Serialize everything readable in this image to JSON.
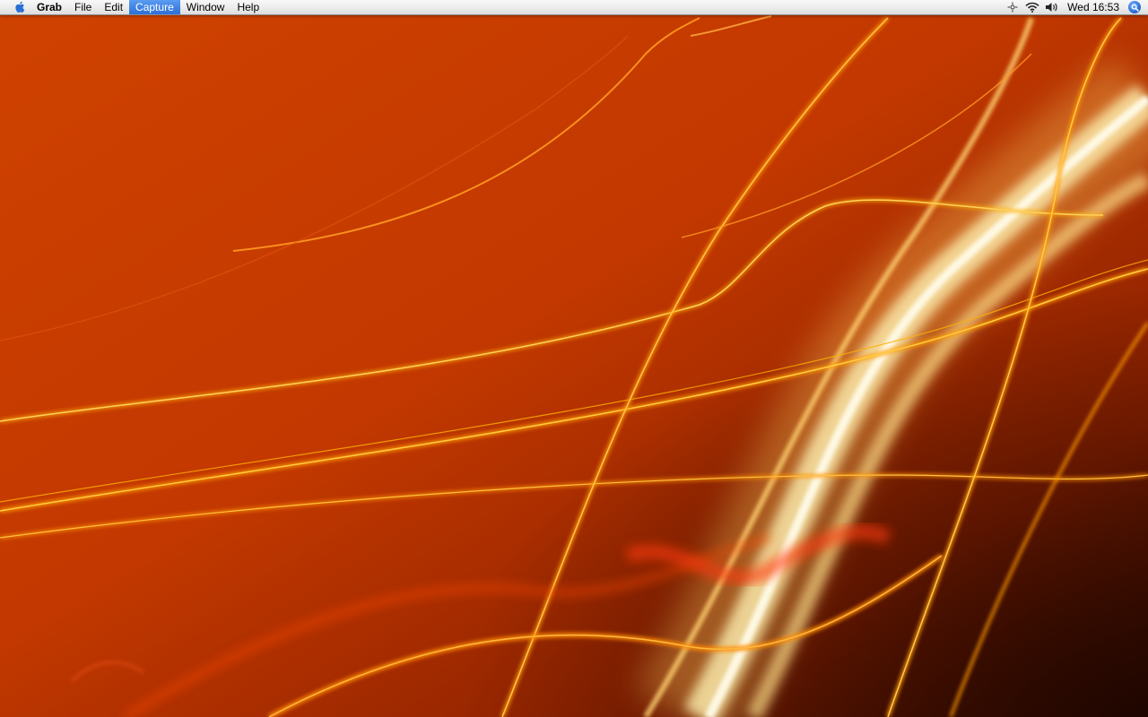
{
  "menubar": {
    "apple_icon": "apple-logo-icon",
    "app_name": "Grab",
    "items": [
      {
        "label": "File"
      },
      {
        "label": "Edit"
      },
      {
        "label": "Capture",
        "active": true
      },
      {
        "label": "Window"
      },
      {
        "label": "Help"
      }
    ],
    "status": {
      "icons": [
        "bluetooth-icon",
        "wifi-icon",
        "volume-icon"
      ],
      "clock": "Wed 16:53",
      "spotlight_icon": "spotlight-search-icon"
    },
    "colors": {
      "active_item": "#2c6fd8",
      "spotlight": "#2a6fd6"
    }
  },
  "desktop": {
    "wallpaper": "orange light streaks",
    "colors": {
      "base": "#c23a00",
      "streak": "#ffb000",
      "highlight": "#fff2c0"
    }
  }
}
